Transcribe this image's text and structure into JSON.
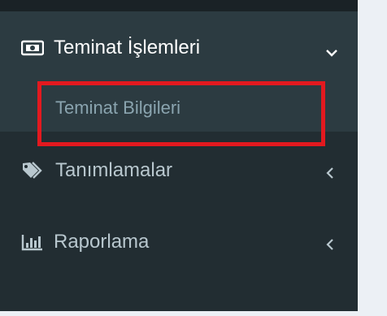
{
  "sidebar": {
    "group": {
      "icon": "money-bill-icon",
      "label": "Teminat İşlemleri",
      "expanded": true,
      "items": [
        {
          "label": "Teminat Bilgileri"
        }
      ]
    },
    "items": [
      {
        "icon": "tags-icon",
        "label": "Tanımlamalar"
      },
      {
        "icon": "bar-chart-icon",
        "label": "Raporlama"
      }
    ]
  },
  "colors": {
    "sidebar_bg": "#222d32",
    "active_bg": "#2c3b41",
    "text_active": "#ffffff",
    "text_muted": "#b8c7ce",
    "highlight": "#e3191f"
  }
}
